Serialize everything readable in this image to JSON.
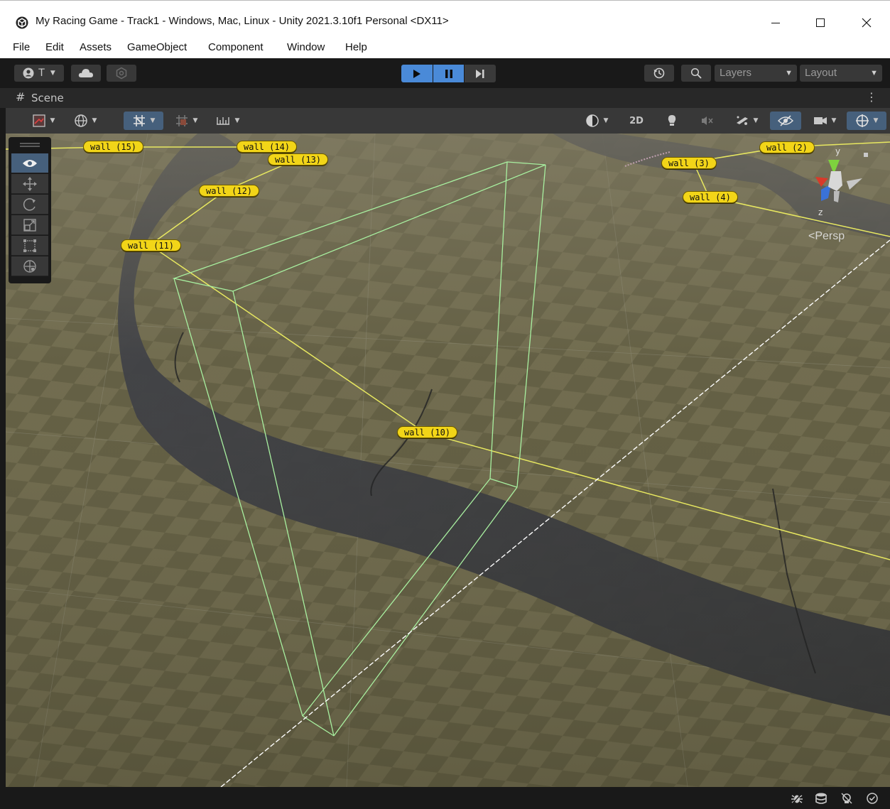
{
  "window": {
    "title": "My Racing Game - Track1 - Windows, Mac, Linux - Unity 2021.3.10f1 Personal <DX11>",
    "controls": {
      "minimize": "—",
      "maximize": "☐",
      "close": "✕"
    }
  },
  "menu": [
    "File",
    "Edit",
    "Assets",
    "GameObject",
    "Component",
    "Window",
    "Help"
  ],
  "toolbar": {
    "account_label": "T",
    "search_icon": "search-icon",
    "layers_label": "Layers",
    "layout_label": "Layout"
  },
  "scene_tab": {
    "label": "Scene"
  },
  "overlay_toolbar": {
    "mode_2d": "2D"
  },
  "viewport": {
    "projection_label": "Persp",
    "gizmo_axes": {
      "y": "y",
      "z": "z"
    },
    "wall_labels": [
      "wall (15)",
      "wall (14)",
      "wall (13)",
      "wall (12)",
      "wall (11)",
      "wall (10)",
      "wall (2)",
      "wall (3)",
      "wall (4)"
    ]
  },
  "colors": {
    "accent_active": "#46607c",
    "play_blue": "#4a8ad8",
    "label_yellow": "#f2d518",
    "gizmo_line": "#e8e860",
    "camera_frustum": "#a8f0a0"
  }
}
